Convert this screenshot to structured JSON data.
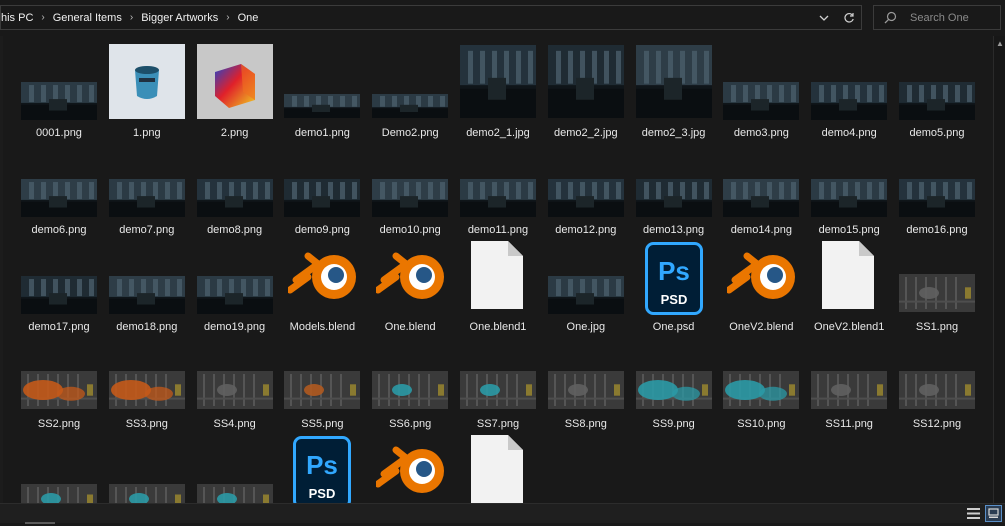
{
  "address_bar": {
    "breadcrumbs": [
      "his PC",
      "General Items",
      "Bigger Artworks",
      "One"
    ],
    "separator": "›",
    "dropdown_icon": "chevron-down-icon",
    "refresh_icon": "refresh-icon"
  },
  "search": {
    "placeholder": "Search One",
    "icon": "search-icon"
  },
  "files": [
    {
      "name": "0001.png",
      "kind": "render"
    },
    {
      "name": "1.png",
      "kind": "object-render"
    },
    {
      "name": "2.png",
      "kind": "gradient-cube-render"
    },
    {
      "name": "demo1.png",
      "kind": "render"
    },
    {
      "name": "Demo2.png",
      "kind": "render"
    },
    {
      "name": "demo2_1.jpg",
      "kind": "render"
    },
    {
      "name": "demo2_2.jpg",
      "kind": "render"
    },
    {
      "name": "demo2_3.jpg",
      "kind": "render"
    },
    {
      "name": "demo3.png",
      "kind": "render"
    },
    {
      "name": "demo4.png",
      "kind": "render"
    },
    {
      "name": "demo5.png",
      "kind": "render"
    },
    {
      "name": "demo6.png",
      "kind": "render"
    },
    {
      "name": "demo7.png",
      "kind": "render"
    },
    {
      "name": "demo8.png",
      "kind": "render"
    },
    {
      "name": "demo9.png",
      "kind": "render"
    },
    {
      "name": "demo10.png",
      "kind": "render"
    },
    {
      "name": "demo11.png",
      "kind": "render"
    },
    {
      "name": "demo12.png",
      "kind": "render"
    },
    {
      "name": "demo13.png",
      "kind": "render"
    },
    {
      "name": "demo14.png",
      "kind": "render"
    },
    {
      "name": "demo15.png",
      "kind": "render"
    },
    {
      "name": "demo16.png",
      "kind": "render"
    },
    {
      "name": "demo17.png",
      "kind": "render"
    },
    {
      "name": "demo18.png",
      "kind": "render"
    },
    {
      "name": "demo19.png",
      "kind": "render"
    },
    {
      "name": "Models.blend",
      "kind": "blender-icon"
    },
    {
      "name": "One.blend",
      "kind": "blender-icon"
    },
    {
      "name": "One.blend1",
      "kind": "blank-file-icon"
    },
    {
      "name": "One.jpg",
      "kind": "render"
    },
    {
      "name": "One.psd",
      "kind": "photoshop-icon"
    },
    {
      "name": "OneV2.blend",
      "kind": "blender-icon"
    },
    {
      "name": "OneV2.blend1",
      "kind": "blank-file-icon"
    },
    {
      "name": "SS1.png",
      "kind": "screenshot"
    },
    {
      "name": "SS2.png",
      "kind": "screenshot"
    },
    {
      "name": "SS3.png",
      "kind": "screenshot"
    },
    {
      "name": "SS4.png",
      "kind": "screenshot"
    },
    {
      "name": "SS5.png",
      "kind": "screenshot"
    },
    {
      "name": "SS6.png",
      "kind": "screenshot"
    },
    {
      "name": "SS7.png",
      "kind": "screenshot"
    },
    {
      "name": "SS8.png",
      "kind": "screenshot"
    },
    {
      "name": "SS9.png",
      "kind": "screenshot"
    },
    {
      "name": "SS10.png",
      "kind": "screenshot"
    },
    {
      "name": "SS11.png",
      "kind": "screenshot"
    },
    {
      "name": "SS12.png",
      "kind": "screenshot"
    },
    {
      "name": "",
      "kind": "screenshot"
    },
    {
      "name": "",
      "kind": "screenshot"
    },
    {
      "name": "",
      "kind": "screenshot"
    },
    {
      "name": "",
      "kind": "photoshop-icon"
    },
    {
      "name": "",
      "kind": "blender-icon"
    },
    {
      "name": "",
      "kind": "blank-file-icon"
    }
  ],
  "photoshop_icon_text": {
    "top": "Ps",
    "bottom": "PSD"
  },
  "status_bar": {
    "details_view_icon": "details-view-icon",
    "thumbnail_view_icon": "large-icons-view-icon"
  },
  "colors": {
    "background": "#191919",
    "text": "#e8e8e8",
    "blender_orange": "#ea7600",
    "blender_blue": "#265787",
    "ps_blue": "#31a8ff",
    "ps_bg": "#001e36"
  }
}
